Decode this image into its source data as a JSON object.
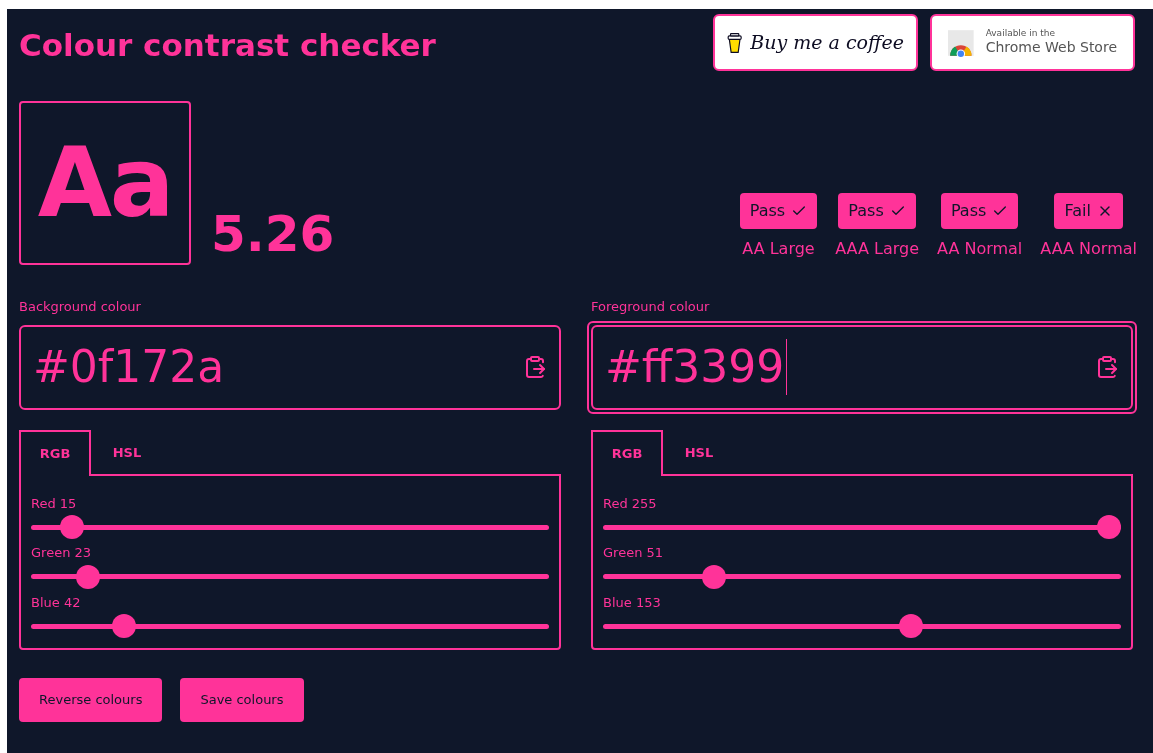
{
  "title": "Colour contrast checker",
  "promo_buttons": [
    {
      "kind": "coffee",
      "label": "Buy me a coffee"
    },
    {
      "kind": "chrome",
      "small": "Available in the",
      "label": "Chrome Web Store"
    }
  ],
  "preview": {
    "sample": "Aa",
    "ratio": "5.26"
  },
  "results": [
    {
      "status": "Pass",
      "passed": true,
      "label": "AA Large"
    },
    {
      "status": "Pass",
      "passed": true,
      "label": "AAA Large"
    },
    {
      "status": "Pass",
      "passed": true,
      "label": "AA Normal"
    },
    {
      "status": "Fail",
      "passed": false,
      "label": "AAA Normal"
    }
  ],
  "colours": [
    {
      "label": "Background colour",
      "value": "#0f172a",
      "focused": false,
      "tabs": [
        {
          "label": "RGB",
          "selected": true
        },
        {
          "label": "HSL",
          "selected": false
        }
      ],
      "sliders": [
        {
          "label": "Red 15",
          "level": 0.0588
        },
        {
          "label": "Green 23",
          "level": 0.0902
        },
        {
          "label": "Blue 42",
          "level": 0.1647
        }
      ]
    },
    {
      "label": "Foreground colour",
      "value": "#ff3399",
      "focused": true,
      "tabs": [
        {
          "label": "RGB",
          "selected": true
        },
        {
          "label": "HSL",
          "selected": false
        }
      ],
      "sliders": [
        {
          "label": "Red 255",
          "level": 1
        },
        {
          "label": "Green 51",
          "level": 0.2
        },
        {
          "label": "Blue 153",
          "level": 0.6
        }
      ]
    }
  ],
  "actions": [
    "Reverse colours",
    "Save colours"
  ]
}
